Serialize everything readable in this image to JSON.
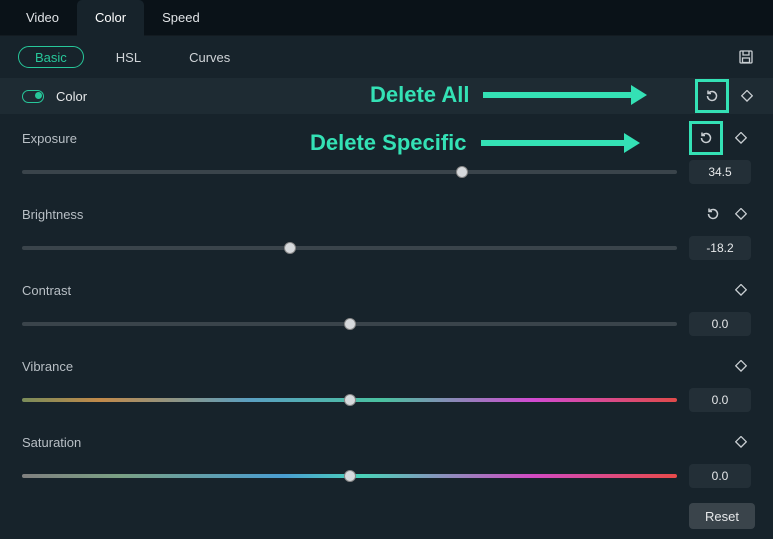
{
  "tabs": {
    "video": "Video",
    "color": "Color",
    "speed": "Speed"
  },
  "subtabs": {
    "basic": "Basic",
    "hsl": "HSL",
    "curves": "Curves"
  },
  "section": {
    "title": "Color"
  },
  "params": {
    "exposure": {
      "label": "Exposure",
      "value": "34.5",
      "pos": 67.2
    },
    "brightness": {
      "label": "Brightness",
      "value": "-18.2",
      "pos": 40.9
    },
    "contrast": {
      "label": "Contrast",
      "value": "0.0",
      "pos": 50
    },
    "vibrance": {
      "label": "Vibrance",
      "value": "0.0",
      "pos": 50
    },
    "saturation": {
      "label": "Saturation",
      "value": "0.0",
      "pos": 50
    }
  },
  "footer": {
    "reset": "Reset"
  },
  "annotations": {
    "all": "Delete All",
    "specific": "Delete Specific"
  }
}
